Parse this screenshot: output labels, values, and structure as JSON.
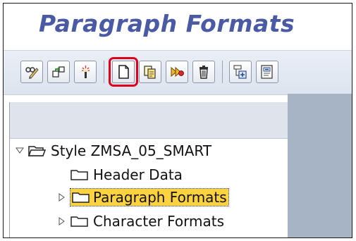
{
  "window": {
    "title": "Paragraph Formats"
  },
  "toolbar": {
    "buttons": [
      {
        "icon": "display-change-icon"
      },
      {
        "icon": "other-object-icon"
      },
      {
        "icon": "activate-icon"
      },
      {
        "icon": "create-icon",
        "highlighted": true
      },
      {
        "icon": "copy-icon"
      },
      {
        "icon": "rename-icon"
      },
      {
        "icon": "delete-icon"
      },
      {
        "icon": "expand-subtree-icon"
      },
      {
        "icon": "collapse-subtree-icon"
      }
    ]
  },
  "tree": {
    "root": {
      "label": "Style ZMSA_05_SMART",
      "expanded": true
    },
    "children": [
      {
        "label": "Header Data",
        "expandable": false,
        "selected": false
      },
      {
        "label": "Paragraph Formats",
        "expandable": true,
        "selected": true
      },
      {
        "label": "Character Formats",
        "expandable": true,
        "selected": false
      }
    ]
  },
  "colors": {
    "title": "#4a5aa5",
    "selection": "#ffd23f",
    "highlight_frame": "#e0001b",
    "right_pane": "#a6b4c6"
  }
}
